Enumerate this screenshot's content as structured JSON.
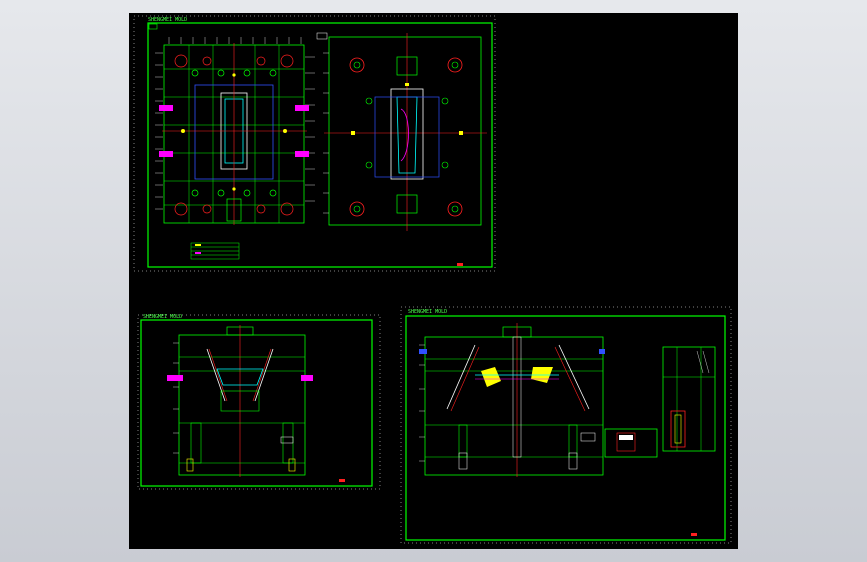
{
  "canvas": {
    "background": "#000000",
    "frame_color": "#00d200",
    "border_color": "#ffffff"
  },
  "sheets": [
    {
      "id": "top",
      "title": "SHENGMEI MOLD",
      "view_labels": [
        "",
        ""
      ]
    },
    {
      "id": "bottom-left",
      "title": "SHENGMEI MOLD"
    },
    {
      "id": "bottom-right",
      "title": "SHENGMEI MOLD"
    }
  ],
  "colors": {
    "green": "#00ff00",
    "red": "#ff2020",
    "yellow": "#ffff00",
    "cyan": "#00ffff",
    "magenta": "#ff00ff",
    "white": "#ffffff",
    "blue": "#3050ff"
  }
}
